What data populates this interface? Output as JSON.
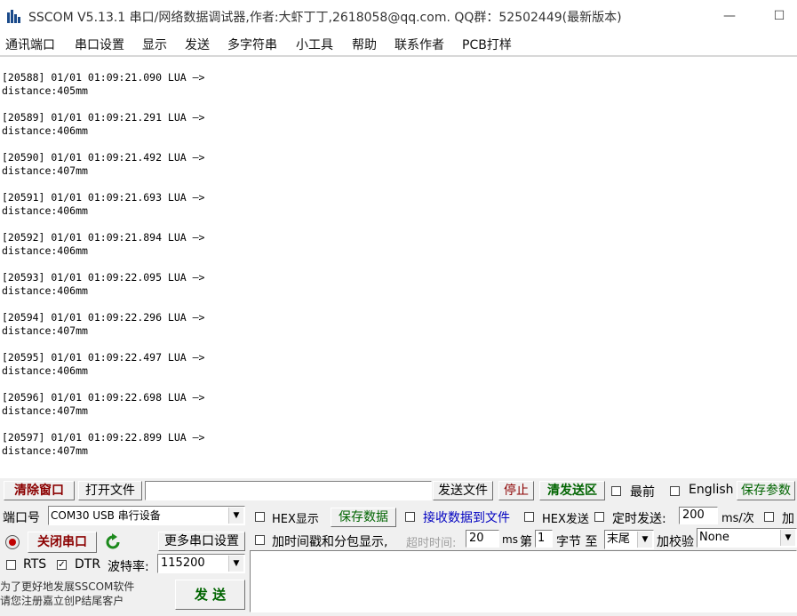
{
  "window": {
    "title": "SSCOM V5.13.1 串口/网络数据调试器,作者:大虾丁丁,2618058@qq.com. QQ群：52502449(最新版本)",
    "minimize_glyph": "—",
    "maximize_glyph": "☐"
  },
  "menu": [
    "通讯端口",
    "串口设置",
    "显示",
    "发送",
    "多字符串",
    "小工具",
    "帮助",
    "联系作者",
    "PCB打样"
  ],
  "log": [
    {
      "header": "[20588] 01/01 01:09:21.090 LUA —>",
      "body": "distance:405mm"
    },
    {
      "header": "[20589] 01/01 01:09:21.291 LUA —>",
      "body": "distance:406mm"
    },
    {
      "header": "[20590] 01/01 01:09:21.492 LUA —>",
      "body": "distance:407mm"
    },
    {
      "header": "[20591] 01/01 01:09:21.693 LUA —>",
      "body": "distance:406mm"
    },
    {
      "header": "[20592] 01/01 01:09:21.894 LUA —>",
      "body": "distance:406mm"
    },
    {
      "header": "[20593] 01/01 01:09:22.095 LUA —>",
      "body": "distance:406mm"
    },
    {
      "header": "[20594] 01/01 01:09:22.296 LUA —>",
      "body": "distance:407mm"
    },
    {
      "header": "[20595] 01/01 01:09:22.497 LUA —>",
      "body": "distance:406mm"
    },
    {
      "header": "[20596] 01/01 01:09:22.698 LUA —>",
      "body": "distance:407mm"
    },
    {
      "header": "[20597] 01/01 01:09:22.899 LUA —>",
      "body": "distance:407mm"
    }
  ],
  "toolbar": {
    "clear_window": "清除窗口",
    "open_file": "打开文件",
    "file_path": "",
    "send_file": "发送文件",
    "stop": "停止",
    "clear_send": "清发送区",
    "topmost": "最前",
    "english": "English",
    "save_params": "保存参数"
  },
  "port": {
    "port_label": "端口号",
    "port_value": "COM30 USB 串行设备",
    "close_port": "关闭串口",
    "more_settings": "更多串口设置",
    "rts": "RTS",
    "dtr": "DTR",
    "dtr_checked": true,
    "baud_label": "波特率:",
    "baud_value": "115200",
    "promo_line1": "为了更好地发展SSCOM软件",
    "promo_line2": "请您注册嘉立创P结尾客户",
    "send": "发 送"
  },
  "options": {
    "hex_display": "HEX显示",
    "save_data": "保存数据",
    "recv_to_file": "接收数据到文件",
    "hex_send": "HEX发送",
    "timed_send": "定时发送:",
    "timed_interval": "200",
    "ms_per": "ms/次",
    "add": "加",
    "timestamp": "加时间戳和分包显示,",
    "timeout_label": "超时时间:",
    "timeout_value": "20",
    "ms": "ms",
    "byte_no_label": "第",
    "byte_no": "1",
    "byte_label": "字节 至",
    "byte_end": "末尾",
    "checksum_label": "加校验",
    "checksum": "None"
  },
  "colors": {
    "accent_red": "#8b0000",
    "accent_green": "#006400",
    "link_blue": "#0000c0"
  },
  "icons": {
    "app": "sscom-app-icon",
    "refresh": "refresh-icon",
    "port_status": "port-led-icon",
    "dropdown": "chevron-down-icon"
  }
}
